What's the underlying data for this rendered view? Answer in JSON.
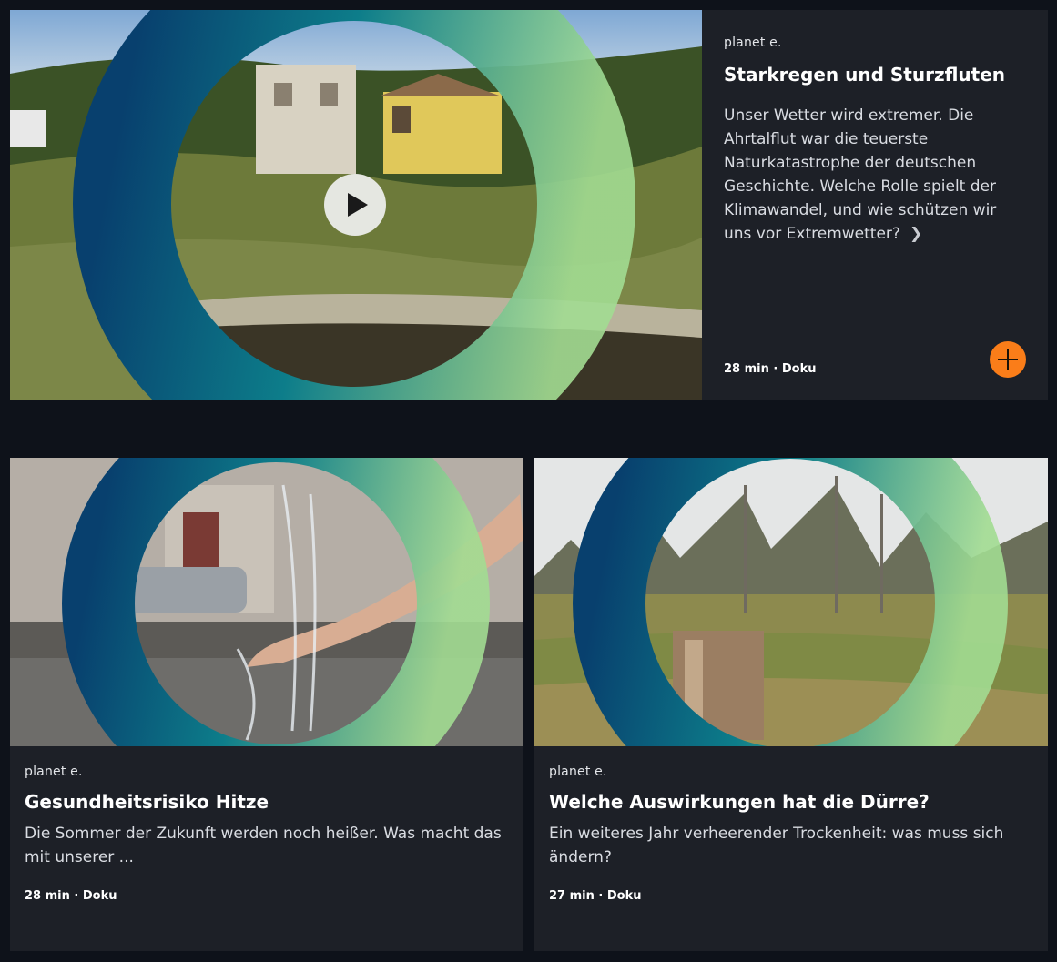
{
  "featured": {
    "brand": "planet e.",
    "title": "Starkregen und Sturzfluten",
    "description": "Unser Wetter wird extremer. Die Ahrtalflut war die teuerste Naturkatastrophe der deutschen Geschichte. Welche Rolle spielt der Klimawandel, und wie schützen wir uns vor Extremwetter?",
    "chevron": "❯",
    "meta": "28 min · Doku",
    "icons": {
      "play": "play-icon",
      "add": "plus-icon",
      "more": "chevron-right-icon"
    },
    "accent": "#fa7d19"
  },
  "cards": [
    {
      "brand": "planet e.",
      "title": "Gesundheitsrisiko Hitze",
      "description": "Die Sommer der Zukunft werden noch heißer. Was macht das mit unserer ...",
      "meta": "28 min · Doku"
    },
    {
      "brand": "planet e.",
      "title": "Welche Auswirkungen hat die Dürre?",
      "description": "Ein weiteres Jahr verheerender Trockenheit: was muss sich ändern?",
      "meta": "27 min · Doku"
    }
  ],
  "colors": {
    "page_bg": "#0e121a",
    "card_bg": "#1d2027",
    "ring_dark": "#08406e",
    "ring_light": "#9ad88e"
  }
}
